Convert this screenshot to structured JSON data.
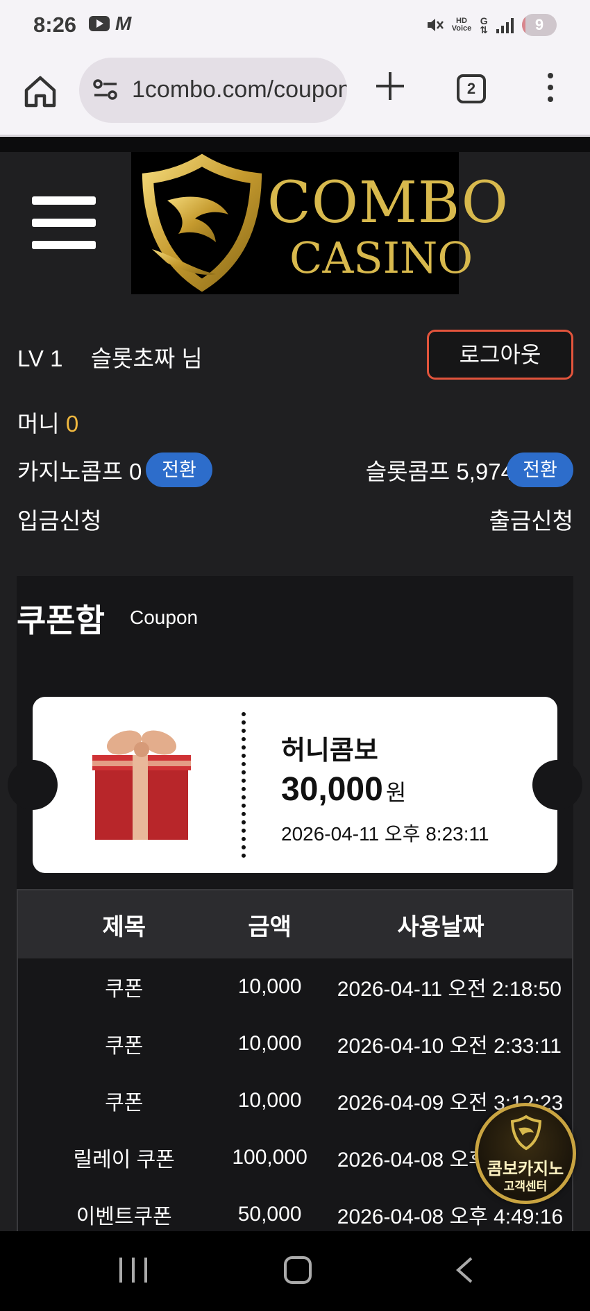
{
  "status_bar": {
    "time": "8:26",
    "left_icons": [
      "youtube-icon",
      "m-icon"
    ],
    "right_icons": [
      "mute-icon",
      "hd-voice-icon",
      "data-icon",
      "signal-icon"
    ],
    "hd_top": "HD",
    "hd_bottom": "Voice",
    "data_letter": "G",
    "battery": "9",
    "battery_level": 0.09
  },
  "browser": {
    "url": "1combo.com/coupon",
    "tab_count": "2",
    "icons": [
      "home-icon",
      "site-settings-icon",
      "new-tab-icon",
      "tab-switcher-icon",
      "more-icon"
    ]
  },
  "site": {
    "logo": {
      "line1": "COMBO",
      "line2": "CASINO"
    },
    "user": {
      "level": "LV 1",
      "name": "슬롯초짜 님"
    },
    "logout_label": "로그아웃",
    "money_label": "머니",
    "money_value": "0",
    "casino_comp_label": "카지노콤프 0",
    "slot_comp_label": "슬롯콤프 5,974",
    "convert_label": "전환",
    "deposit_label": "입금신청",
    "withdraw_label": "출금신청"
  },
  "coupon": {
    "title": "쿠폰함",
    "subtitle": "Coupon",
    "ticket": {
      "name": "허니콤보",
      "amount": "30,000",
      "unit": "원",
      "date": "2026-04-11 오후 8:23:11"
    }
  },
  "table": {
    "headers": [
      "제목",
      "금액",
      "사용날짜"
    ],
    "rows": [
      {
        "title": "쿠폰",
        "amount": "10,000",
        "date": "2026-04-11 오전 2:18:50"
      },
      {
        "title": "쿠폰",
        "amount": "10,000",
        "date": "2026-04-10 오전 2:33:11"
      },
      {
        "title": "쿠폰",
        "amount": "10,000",
        "date": "2026-04-09 오전 3:12:23"
      },
      {
        "title": "릴레이 쿠폰",
        "amount": "100,000",
        "date": "2026-04-08 오후 5:10:10"
      },
      {
        "title": "이벤트쿠폰",
        "amount": "50,000",
        "date": "2026-04-08 오후 4:49:16"
      }
    ]
  },
  "cs_badge": {
    "line1": "콤보카지노",
    "line2": "고객센터"
  },
  "colors": {
    "site_bg": "#1f1f21",
    "gold": "#d8b94d",
    "money_accent": "#f0b83f",
    "logout_border": "#e2543c",
    "convert_button": "#2d6dcb"
  }
}
